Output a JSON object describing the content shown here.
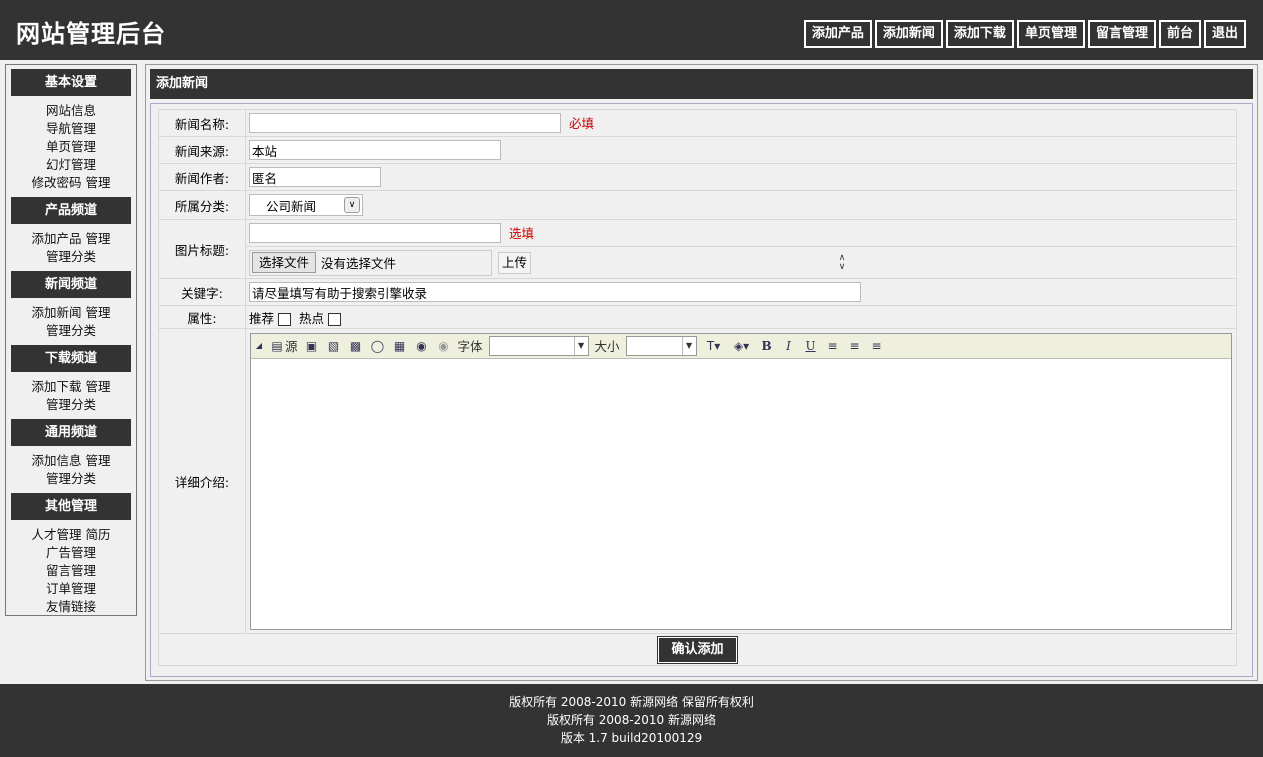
{
  "header": {
    "title": "网站管理后台",
    "nav": [
      "添加产品",
      "添加新闻",
      "添加下载",
      "单页管理",
      "留言管理",
      "前台",
      "退出"
    ]
  },
  "sidebar": {
    "groups": [
      {
        "title": "基本设置",
        "items": [
          "网站信息",
          "导航管理",
          "单页管理",
          "幻灯管理",
          "修改密码 管理"
        ]
      },
      {
        "title": "产品频道",
        "items": [
          "添加产品 管理",
          "管理分类"
        ]
      },
      {
        "title": "新闻频道",
        "items": [
          "添加新闻 管理",
          "管理分类"
        ]
      },
      {
        "title": "下载频道",
        "items": [
          "添加下载 管理",
          "管理分类"
        ]
      },
      {
        "title": "通用频道",
        "items": [
          "添加信息 管理",
          "管理分类"
        ]
      },
      {
        "title": "其他管理",
        "items": [
          "人才管理 简历",
          "广告管理",
          "留言管理",
          "订单管理",
          "友情链接"
        ]
      }
    ]
  },
  "panel": {
    "title": "添加新闻",
    "fields": {
      "name_label": "新闻名称:",
      "name_value": "",
      "name_hint": "必填",
      "source_label": "新闻来源:",
      "source_value": "本站",
      "author_label": "新闻作者:",
      "author_value": "匿名",
      "category_label": "所属分类:",
      "category_value": "公司新闻",
      "image_label": "图片标题:",
      "image_value": "",
      "image_hint": "选填",
      "choose_file": "选择文件",
      "no_file": "没有选择文件",
      "upload": "上传",
      "keywords_label": "关键字:",
      "keywords_value": "请尽量填写有助于搜索引擎收录",
      "attr_label": "属性:",
      "attr_recommend": "推荐",
      "attr_hot": "热点",
      "detail_label": "详细介绍:"
    },
    "editor_toolbar": {
      "source": "源",
      "font_label": "字体",
      "size_label": "大小",
      "icons": [
        "source-icon",
        "preview-icon",
        "paste-icon",
        "image-icon",
        "flash-icon",
        "table-icon",
        "link-icon",
        "unlink-icon",
        "text-color-icon",
        "bg-color-icon",
        "bold-icon",
        "italic-icon",
        "underline-icon",
        "align-left-icon",
        "align-center-icon",
        "align-right-icon"
      ]
    },
    "submit": "确认添加"
  },
  "footer": {
    "line1": "版权所有 2008-2010 新源网络 保留所有权利",
    "line2": "版权所有 2008-2010 新源网络",
    "line3": "版本 1.7 build20100129"
  }
}
